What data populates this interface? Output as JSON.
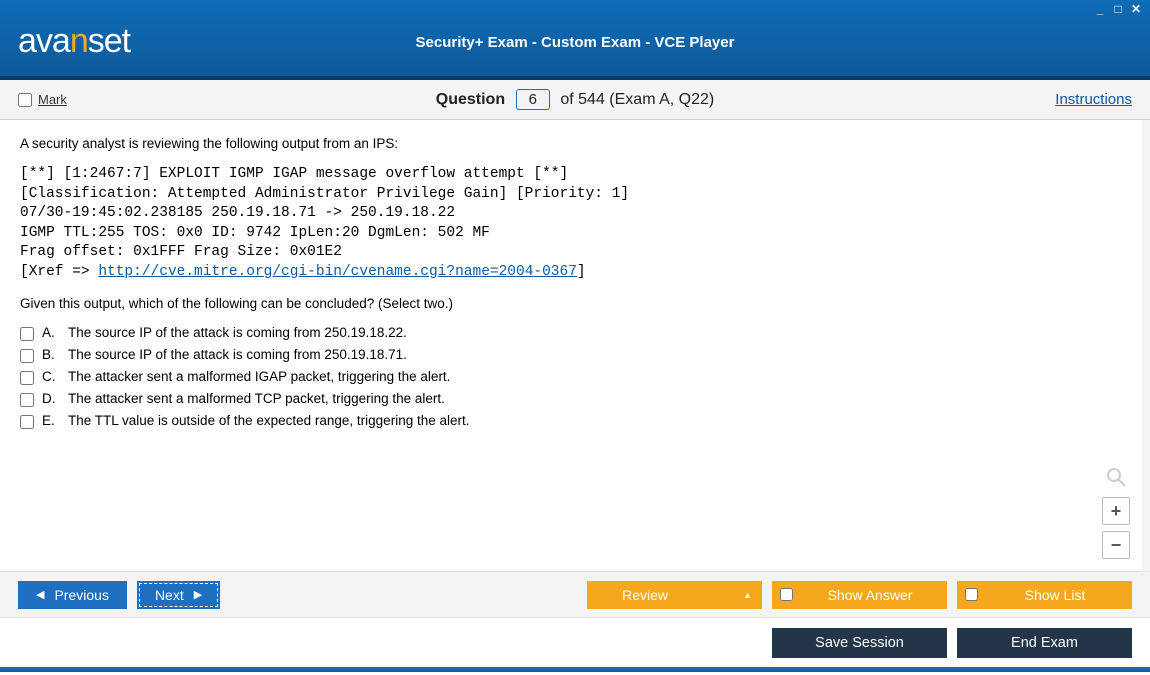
{
  "window": {
    "title": "Security+ Exam - Custom Exam - VCE Player",
    "brand_pre": "ava",
    "brand_n": "n",
    "brand_post": "set"
  },
  "toolbar": {
    "mark_label": "Mark",
    "question_word": "Question",
    "question_number": "6",
    "question_suffix": "of 544 (Exam A, Q22)",
    "instructions": "Instructions"
  },
  "question": {
    "prompt1": "A security analyst is reviewing the following output from an IPS:",
    "code_line1": "[**] [1:2467:7] EXPLOIT IGMP IGAP message overflow attempt [**]",
    "code_line2": "[Classification: Attempted Administrator Privilege Gain] [Priority: 1]",
    "code_line3": "07/30-19:45:02.238185 250.19.18.71 -> 250.19.18.22",
    "code_line4": "IGMP TTL:255 TOS: 0x0 ID: 9742 IpLen:20 DgmLen: 502 MF",
    "code_line5": "Frag offset: 0x1FFF Frag Size: 0x01E2",
    "code_line6_pre": "[Xref => ",
    "code_line6_url": "http://cve.mitre.org/cgi-bin/cvename.cgi?name=2004-0367",
    "code_line6_post": "]",
    "prompt2": "Given this output, which of the following can be concluded? (Select two.)",
    "answers": [
      {
        "letter": "A.",
        "text": "The source IP of the attack is coming from 250.19.18.22."
      },
      {
        "letter": "B.",
        "text": "The source IP of the attack is coming from 250.19.18.71."
      },
      {
        "letter": "C.",
        "text": "The attacker sent a malformed IGAP packet, triggering the alert."
      },
      {
        "letter": "D.",
        "text": "The attacker sent a malformed TCP packet, triggering the alert."
      },
      {
        "letter": "E.",
        "text": "The TTL value is outside of the expected range, triggering the alert."
      }
    ]
  },
  "nav": {
    "previous": "Previous",
    "next": "Next",
    "review": "Review",
    "show_answer": "Show Answer",
    "show_list": "Show List",
    "save_session": "Save Session",
    "end_exam": "End Exam"
  }
}
